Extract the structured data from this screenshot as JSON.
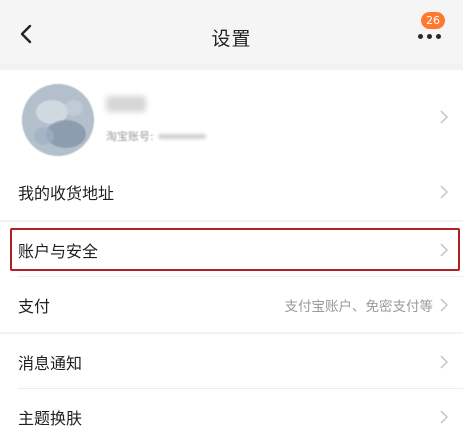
{
  "header": {
    "title": "设置",
    "badge_count": "26",
    "back_icon": "chevron-left-icon",
    "more_icon": "more-dots-icon"
  },
  "profile": {
    "account_label": "淘宝账号:"
  },
  "rows": {
    "address": {
      "label": "我的收货地址"
    },
    "account_security": {
      "label": "账户与安全"
    },
    "payment": {
      "label": "支付",
      "value": "支付宝账户、免密支付等"
    },
    "notifications": {
      "label": "消息通知"
    },
    "theme": {
      "label": "主题换肤"
    }
  },
  "colors": {
    "background": "#f2f2f2",
    "card": "#ffffff",
    "badge": "#ff7a2e",
    "highlight": "#b01f24",
    "secondary_text": "#9a9a9a"
  }
}
